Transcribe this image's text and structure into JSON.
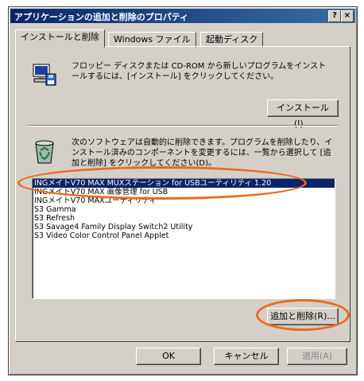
{
  "window": {
    "title": "アプリケーションの追加と削除のプロパティ",
    "help_label": "?",
    "close_label": "×"
  },
  "tabs": [
    {
      "label": "インストールと削除"
    },
    {
      "label": "Windows ファイル"
    },
    {
      "label": "起動ディスク"
    }
  ],
  "install_section": {
    "description": "フロッピー ディスクまたは CD-ROM から新しいプログラムをインストールするには、[インストール] をクリックしてください。",
    "install_button": "インストール(I)..."
  },
  "remove_section": {
    "description": "次のソフトウェアは自動的に削除できます。プログラムを削除したり、インストール済みのコンポーネントを変更するには、一覧から選択して [追加と削除] をクリックしてください(D)。",
    "programs": [
      "INGメイトV70 MAX MUXステーション for USBユーティリティ 1.20",
      "INGメイトV70 MAX 画像管理 for USB",
      "INGメイトV70 MAXユーティリティ",
      "S3 Gamma",
      "S3 Refresh",
      "S3 Savage4 Family Display Switch2 Utility",
      "S3 Video Color Control Panel Applet"
    ],
    "selected_index": 0,
    "add_remove_button": "追加と削除(R)..."
  },
  "footer": {
    "ok": "OK",
    "cancel": "キャンセル",
    "apply": "適用(A)"
  },
  "colors": {
    "highlight_ring": "#ee6a1e",
    "selection": "#0a246a"
  }
}
